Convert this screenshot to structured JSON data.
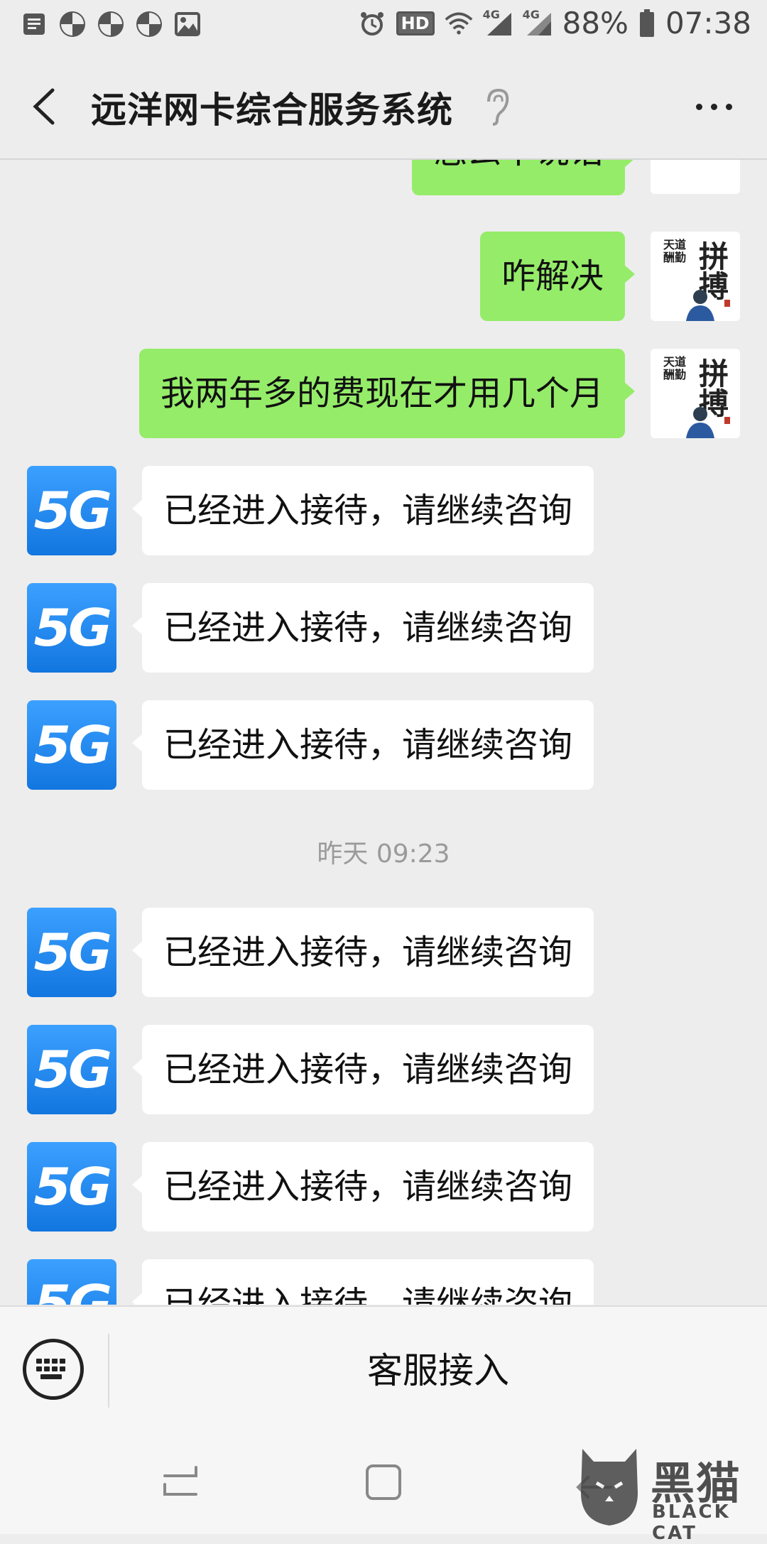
{
  "status_bar": {
    "battery": "88%",
    "time": "07:38",
    "hd_label": "HD",
    "net_label_1": "4G",
    "net_label_2": "4G"
  },
  "header": {
    "title": "远洋网卡综合服务系统"
  },
  "messages": {
    "out_partial": "怎么不说话",
    "out_1": "咋解决",
    "out_2": "我两年多的费现在才用几个月",
    "in_text": "已经进入接待，请继续咨询",
    "timestamp": "昨天 09:23",
    "avatar_logo": "5G"
  },
  "input_bar": {
    "service_label": "客服接入"
  },
  "watermark": {
    "cn": "黑猫",
    "en": "BLACK CAT"
  },
  "colors": {
    "outgoing_bubble": "#95ec69",
    "incoming_bubble": "#ffffff",
    "background": "#ededed",
    "logo_blue": "#1a86ee"
  }
}
